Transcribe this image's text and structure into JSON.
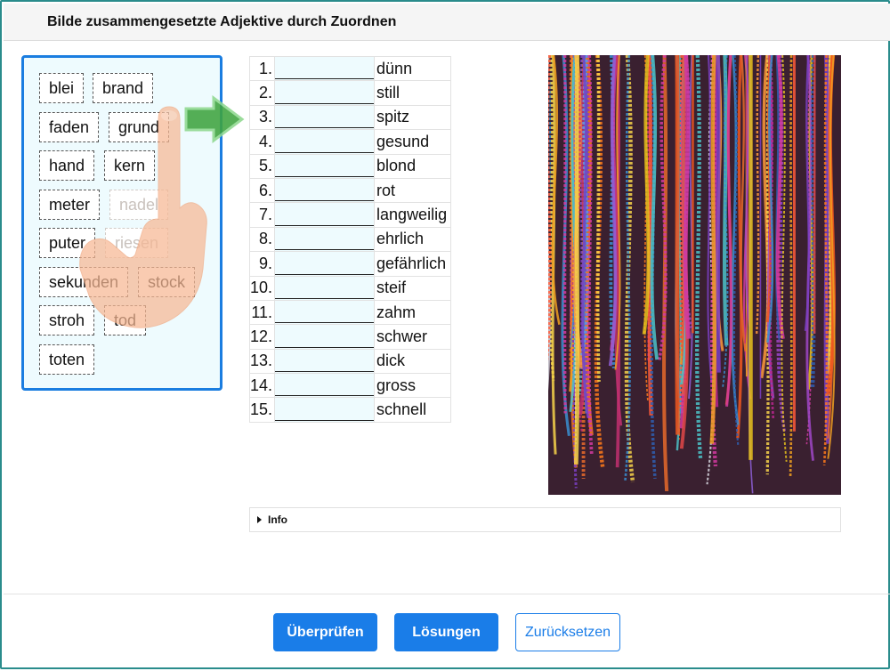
{
  "title": "Bilde zusammengesetzte Adjektive durch Zuordnen",
  "word_bank": {
    "chips": [
      "blei",
      "brand",
      "faden",
      "grund",
      "hand",
      "kern",
      "meter",
      "nadel",
      "puter",
      "riesen",
      "sekunden",
      "stock",
      "stroh",
      "tod",
      "toten"
    ],
    "ghosted": [
      "nadel",
      "riesen"
    ]
  },
  "exercise": {
    "rows": [
      {
        "num": "1.",
        "word": "dünn"
      },
      {
        "num": "2.",
        "word": "still"
      },
      {
        "num": "3.",
        "word": "spitz"
      },
      {
        "num": "4.",
        "word": "gesund"
      },
      {
        "num": "5.",
        "word": "blond"
      },
      {
        "num": "6.",
        "word": "rot"
      },
      {
        "num": "7.",
        "word": "langweilig"
      },
      {
        "num": "8.",
        "word": "ehrlich"
      },
      {
        "num": "9.",
        "word": "gefährlich"
      },
      {
        "num": "10.",
        "word": "steif"
      },
      {
        "num": "11.",
        "word": "zahm"
      },
      {
        "num": "12.",
        "word": "schwer"
      },
      {
        "num": "13.",
        "word": "dick"
      },
      {
        "num": "14.",
        "word": "gross"
      },
      {
        "num": "15.",
        "word": "schnell"
      }
    ]
  },
  "info": {
    "label": "Info"
  },
  "buttons": {
    "check": "Überprüfen",
    "solutions": "Lösungen",
    "reset": "Zurücksetzen"
  },
  "photo": {
    "subject": "colorful braided cords"
  },
  "colors": {
    "accent": "#1a7de8",
    "frame": "#2a8c8c",
    "bank_bg": "#eefbfe",
    "hint_arrow": "#4caf50",
    "hint_hand": "#f6b894"
  },
  "icons": {
    "hint_hand": "pointing-hand-icon",
    "hint_arrow": "right-arrow-icon",
    "info_toggle": "triangle-right-icon"
  }
}
